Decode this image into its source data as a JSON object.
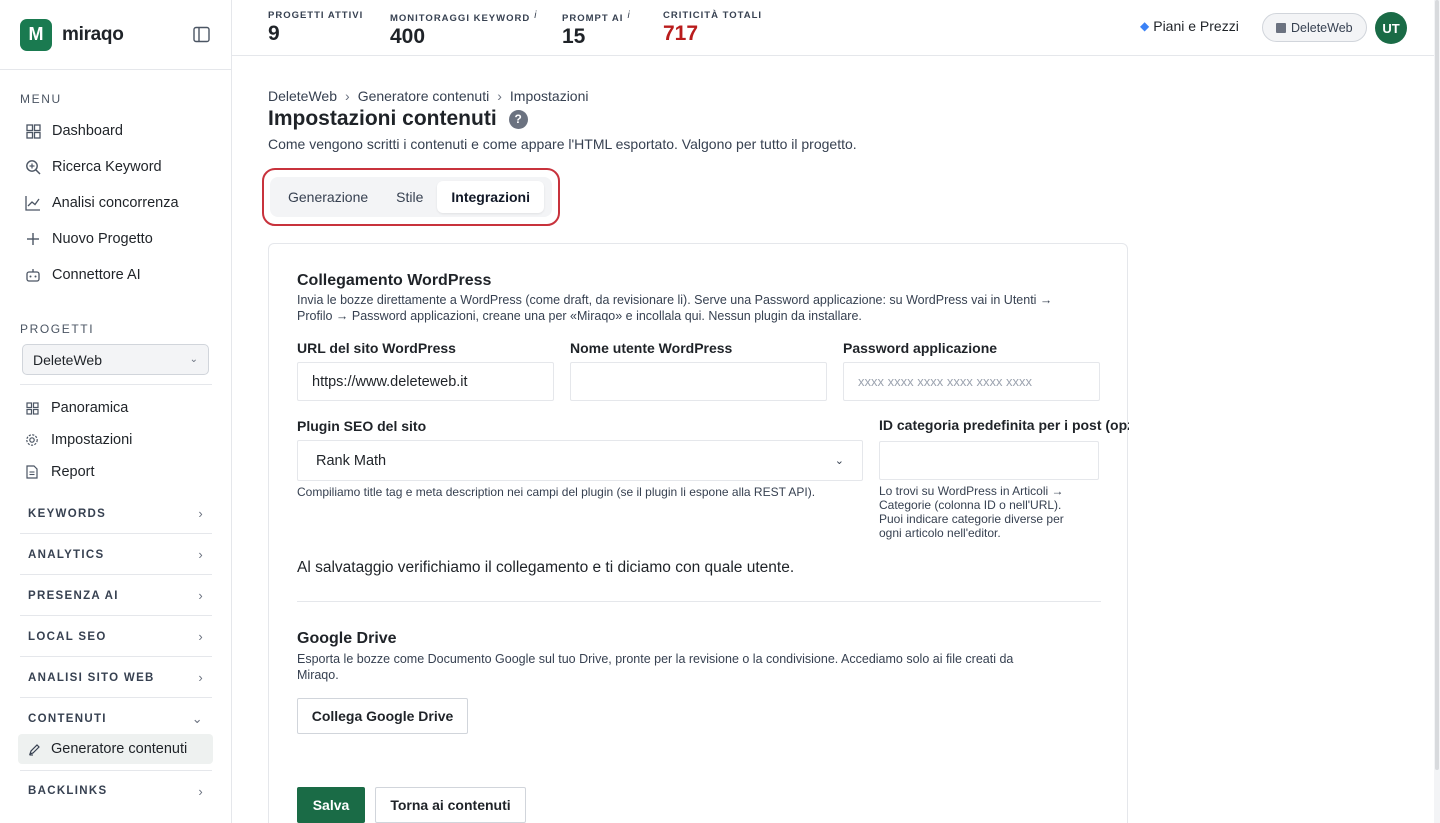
{
  "brand": {
    "logo_letter": "M",
    "name": "miraqo",
    "accent": "#1a7a50"
  },
  "sidebar": {
    "menu_label": "MENU",
    "menu": [
      {
        "label": "Dashboard",
        "icon": "grid-icon"
      },
      {
        "label": "Ricerca Keyword",
        "icon": "search-icon"
      },
      {
        "label": "Analisi concorrenza",
        "icon": "chart-line-icon"
      },
      {
        "label": "Nuovo Progetto",
        "icon": "plus-icon"
      },
      {
        "label": "Connettore AI",
        "icon": "robot-icon"
      }
    ],
    "projects_label": "PROGETTI",
    "project_selected": "DeleteWeb",
    "project_items": [
      {
        "label": "Panoramica",
        "icon": "grid-icon"
      },
      {
        "label": "Impostazioni",
        "icon": "gear-icon"
      },
      {
        "label": "Report",
        "icon": "document-icon"
      }
    ],
    "groups": [
      {
        "label": "KEYWORDS"
      },
      {
        "label": "ANALYTICS"
      },
      {
        "label": "PRESENZA AI"
      },
      {
        "label": "LOCAL SEO"
      },
      {
        "label": "ANALISI SITO WEB"
      },
      {
        "label": "CONTENUTI"
      },
      {
        "label": "BACKLINKS"
      }
    ],
    "active_item": "Generatore contenuti"
  },
  "topbar": {
    "stats": [
      {
        "label": "PROGETTI ATTIVI",
        "value": "9",
        "info": ""
      },
      {
        "label": "MONITORAGGI KEYWORD",
        "value": "400",
        "info": "i"
      },
      {
        "label": "PROMPT AI",
        "value": "15",
        "info": "i"
      },
      {
        "label": "CRITICITÀ TOTALI",
        "value": "717",
        "info": ""
      }
    ],
    "plans_label": "Piani e Prezzi",
    "project_pill": "DeleteWeb",
    "avatar_initials": "UT"
  },
  "breadcrumb": [
    "DeleteWeb",
    "Generatore contenuti",
    "Impostazioni"
  ],
  "breadcrumb_sep": "›",
  "page": {
    "title": "Impostazioni contenuti",
    "help": "?",
    "subtitle": "Come vengono scritti i contenuti e come appare l'HTML esportato. Valgono per tutto il progetto."
  },
  "tabs": [
    {
      "label": "Generazione"
    },
    {
      "label": "Stile"
    },
    {
      "label": "Integrazioni"
    }
  ],
  "wordpress": {
    "title": "Collegamento WordPress",
    "desc_line1": "Invia le bozze direttamente a WordPress (come draft, da revisionare li). Serve una Password applicazione: su WordPress vai in Utenti →",
    "desc_line2": "Profilo → Password applicazioni, creane una per «Miraqo» e incollala qui. Nessun plugin da installare.",
    "url_label": "URL del sito WordPress",
    "url_value": "https://www.deleteweb.it",
    "user_label": "Nome utente WordPress",
    "user_value": "",
    "pass_label": "Password applicazione",
    "pass_placeholder": "xxxx xxxx xxxx xxxx xxxx xxxx",
    "seo_label": "Plugin SEO del sito",
    "seo_value": "Rank Math",
    "seo_help": "Compiliamo title tag e meta description nei campi del plugin (se il plugin li espone alla REST API).",
    "cat_label": "ID categoria predefinita per i post (opzionale)",
    "cat_value": "",
    "cat_help_1": "Lo trovi su WordPress in Articoli →",
    "cat_help_2": "Categorie (colonna ID o nell'URL).",
    "cat_help_3": "Puoi indicare categorie diverse per",
    "cat_help_4": "ogni articolo nell'editor.",
    "verify_note": "Al salvataggio verifichiamo il collegamento e ti diciamo con quale utente."
  },
  "gdrive": {
    "title": "Google Drive",
    "desc_line1": "Esporta le bozze come Documento Google sul tuo Drive, pronte per la revisione o la condivisione. Accediamo solo ai file creati da",
    "desc_line2": "Miraqo.",
    "connect_label": "Collega Google Drive"
  },
  "actions": {
    "save_label": "Salva",
    "back_label": "Torna ai contenuti"
  }
}
